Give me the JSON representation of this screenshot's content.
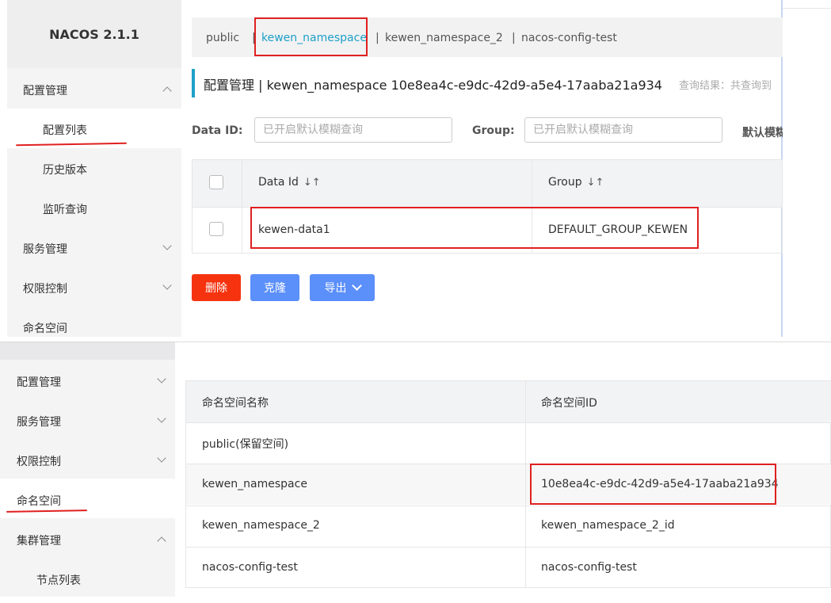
{
  "top_panel": {
    "logo": "NACOS 2.1.1",
    "sidebar": {
      "config_mgmt": "配置管理",
      "config_list": "配置列表",
      "history": "历史版本",
      "listen_query": "监听查询",
      "service_mgmt": "服务管理",
      "access_control": "权限控制",
      "namespace": "命名空间"
    },
    "tabs": [
      "public",
      "kewen_namespace",
      "kewen_namespace_2",
      "nacos-config-test"
    ],
    "tab_separator": "|",
    "title": "配置管理 | kewen_namespace 10e8ea4c-e9dc-42d9-a5e4-17aaba21a934",
    "query_result": "查询结果：共查询到",
    "search": {
      "data_id_label": "Data ID:",
      "data_id_placeholder": "已开启默认模糊查询",
      "group_label": "Group:",
      "group_placeholder": "已开启默认模糊查询",
      "default_fuzzy": "默认模糊"
    },
    "table": {
      "columns": [
        "Data Id",
        "Group"
      ],
      "sort_icon": "↓↑",
      "rows": [
        {
          "data_id": "kewen-data1",
          "group": "DEFAULT_GROUP_KEWEN"
        }
      ]
    },
    "buttons": {
      "delete": "删除",
      "clone": "克隆",
      "export": "导出"
    },
    "colors": {
      "accent": "#1ea0c8",
      "delete": "#f5330f",
      "primary": "#5b8ff9",
      "annotation": "#e02020"
    }
  },
  "bottom_panel": {
    "sidebar": {
      "config_mgmt": "配置管理",
      "service_mgmt": "服务管理",
      "access_control": "权限控制",
      "namespace": "命名空间",
      "cluster_mgmt": "集群管理",
      "node_list": "节点列表"
    },
    "table": {
      "columns": [
        "命名空间名称",
        "命名空间ID"
      ],
      "rows": [
        {
          "name": "public(保留空间)",
          "id": ""
        },
        {
          "name": "kewen_namespace",
          "id": "10e8ea4c-e9dc-42d9-a5e4-17aaba21a934"
        },
        {
          "name": "kewen_namespace_2",
          "id": "kewen_namespace_2_id"
        },
        {
          "name": "nacos-config-test",
          "id": "nacos-config-test"
        }
      ]
    }
  }
}
